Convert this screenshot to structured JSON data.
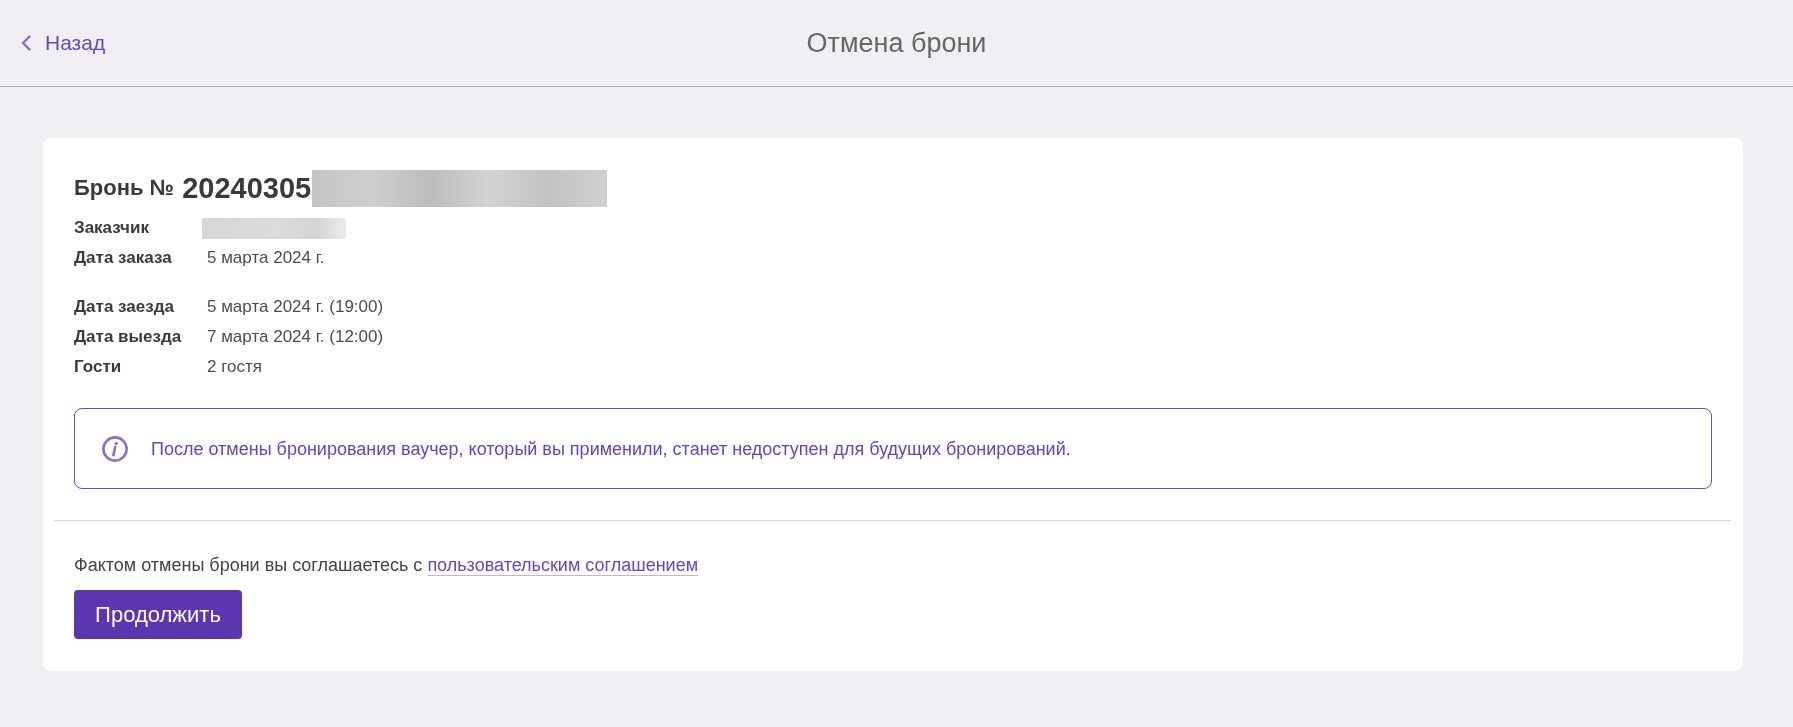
{
  "header": {
    "back_link": "Назад",
    "title": "Отмена брони"
  },
  "booking": {
    "label": "Бронь №",
    "number": "20240305",
    "number_redacted": true,
    "order_details": [
      {
        "label": "Заказчик",
        "redacted": true
      },
      {
        "label": "Дата заказа",
        "value": "5 марта 2024 г.",
        "redacted": false
      }
    ],
    "stay_details": [
      {
        "label": "Дата заезда",
        "value": "5 марта 2024 г. (19:00)",
        "redacted": false
      },
      {
        "label": "Дата выезда",
        "value": "7 марта 2024 г. (12:00)",
        "redacted": false
      },
      {
        "label": "Гости",
        "value": "2 гостя",
        "redacted": false
      }
    ],
    "notice": {
      "text": "После отмены бронирования ваучер, который вы применили, станет недоступен для будущих бронирований."
    },
    "agreement": {
      "text": "Фактом отмены брони вы соглашаетесь с",
      "link": "пользовательским соглашением"
    },
    "continue_button": "Продолжить"
  }
}
